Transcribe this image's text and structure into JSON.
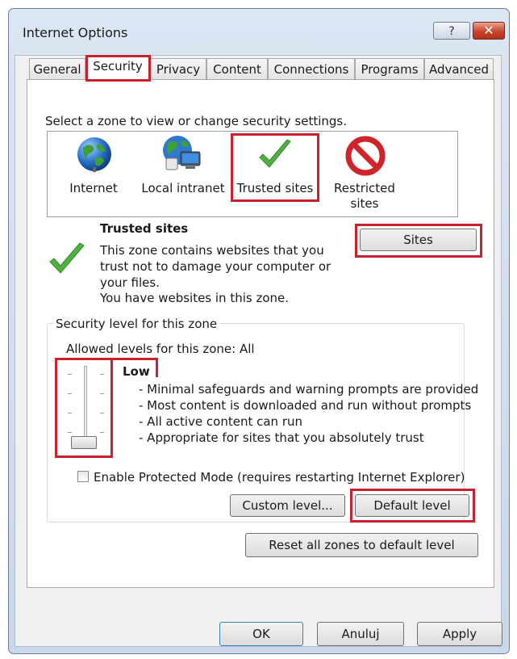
{
  "window": {
    "title": "Internet Options"
  },
  "titlebar": {
    "help_glyph": "?",
    "close_glyph": "✕"
  },
  "tabs": [
    {
      "label": "General"
    },
    {
      "label": "Security"
    },
    {
      "label": "Privacy"
    },
    {
      "label": "Content"
    },
    {
      "label": "Connections"
    },
    {
      "label": "Programs"
    },
    {
      "label": "Advanced"
    }
  ],
  "active_tab": "Security",
  "zones": {
    "prompt": "Select a zone to view or change security settings.",
    "items": [
      {
        "label": "Internet",
        "icon": "globe-icon"
      },
      {
        "label": "Local intranet",
        "icon": "network-globe-icon"
      },
      {
        "label": "Trusted sites",
        "icon": "checkmark-icon",
        "selected": true
      },
      {
        "label": "Restricted",
        "label2": "sites",
        "icon": "no-entry-icon"
      }
    ]
  },
  "selected_zone": {
    "name": "Trusted sites",
    "desc1": "This zone contains websites that you",
    "desc2": "trust not to damage your computer or",
    "desc3": "your files.",
    "desc4": "You have websites in this zone.",
    "sites_button": "Sites"
  },
  "security_level": {
    "group_label": "Security level for this zone",
    "allowed": "Allowed levels for this zone: All",
    "level": "Low",
    "bullets": [
      "- Minimal safeguards and warning prompts are provided",
      "- Most content is downloaded and run without prompts",
      "- All active content can run",
      "- Appropriate for sites that you absolutely trust"
    ],
    "protected_mode_label": "Enable Protected Mode (requires restarting Internet Explorer)",
    "protected_mode_checked": false,
    "custom_button": "Custom level...",
    "default_button": "Default level"
  },
  "reset_button": "Reset all zones to default level",
  "footer": {
    "ok": "OK",
    "cancel": "Anuluj",
    "apply": "Apply"
  },
  "colors": {
    "highlight": "#c8222f",
    "check_green": "#4fae3a",
    "no_red": "#d0242b",
    "accent_blue": "#3a7bd5"
  }
}
